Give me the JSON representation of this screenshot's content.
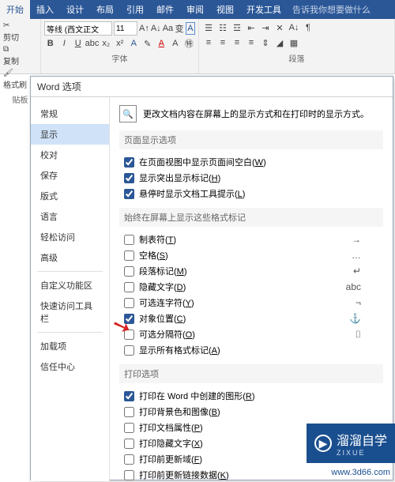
{
  "ribbon": {
    "tabs": [
      "开始",
      "插入",
      "设计",
      "布局",
      "引用",
      "邮件",
      "审阅",
      "视图",
      "开发工具"
    ],
    "tell_me": "告诉我你想要做什么",
    "clipboard": {
      "cut": "剪切",
      "copy": "复制",
      "painter": "格式刷",
      "label": "贴板"
    },
    "font": {
      "name": "等线 (西文正文",
      "size": "11",
      "label": "字体"
    },
    "para_label": "段落"
  },
  "dialog": {
    "title": "Word 选项",
    "sidebar": {
      "items": [
        "常规",
        "显示",
        "校对",
        "保存",
        "版式",
        "语言",
        "轻松访问",
        "高级"
      ],
      "items2": [
        "自定义功能区",
        "快速访问工具栏"
      ],
      "items3": [
        "加载项",
        "信任中心"
      ]
    },
    "content": {
      "intro": "更改文档内容在屏幕上的显示方式和在打印时的显示方式。",
      "sec1": "页面显示选项",
      "sec2": "始终在屏幕上显示这些格式标记",
      "sec3": "打印选项",
      "page_opts": [
        {
          "label": "在页面视图中显示页面间空白",
          "hot": "W",
          "checked": true
        },
        {
          "label": "显示突出显示标记",
          "hot": "H",
          "checked": true
        },
        {
          "label": "悬停时显示文档工具提示",
          "hot": "L",
          "checked": true
        }
      ],
      "mark_opts": [
        {
          "label": "制表符",
          "hot": "T",
          "checked": false,
          "sym": "→"
        },
        {
          "label": "空格",
          "hot": "S",
          "checked": false,
          "sym": "…"
        },
        {
          "label": "段落标记",
          "hot": "M",
          "checked": false,
          "sym": "↵"
        },
        {
          "label": "隐藏文字",
          "hot": "D",
          "checked": false,
          "sym": "abc"
        },
        {
          "label": "可选连字符",
          "hot": "Y",
          "checked": false,
          "sym": "¬"
        },
        {
          "label": "对象位置",
          "hot": "C",
          "checked": true,
          "sym": "⚓"
        },
        {
          "label": "可选分隔符",
          "hot": "O",
          "checked": false,
          "sym": "⌷"
        },
        {
          "label": "显示所有格式标记",
          "hot": "A",
          "checked": false,
          "sym": ""
        }
      ],
      "print_opts": [
        {
          "label": "打印在 Word 中创建的图形",
          "hot": "R",
          "checked": true
        },
        {
          "label": "打印背景色和图像",
          "hot": "B",
          "checked": false
        },
        {
          "label": "打印文档属性",
          "hot": "P",
          "checked": false
        },
        {
          "label": "打印隐藏文字",
          "hot": "X",
          "checked": false
        },
        {
          "label": "打印前更新域",
          "hot": "F",
          "checked": false
        },
        {
          "label": "打印前更新链接数据",
          "hot": "K",
          "checked": false
        }
      ]
    }
  },
  "watermark": {
    "brand": "溜溜自学",
    "sub": "ZIXUE",
    "url": "www.3d66.com"
  }
}
